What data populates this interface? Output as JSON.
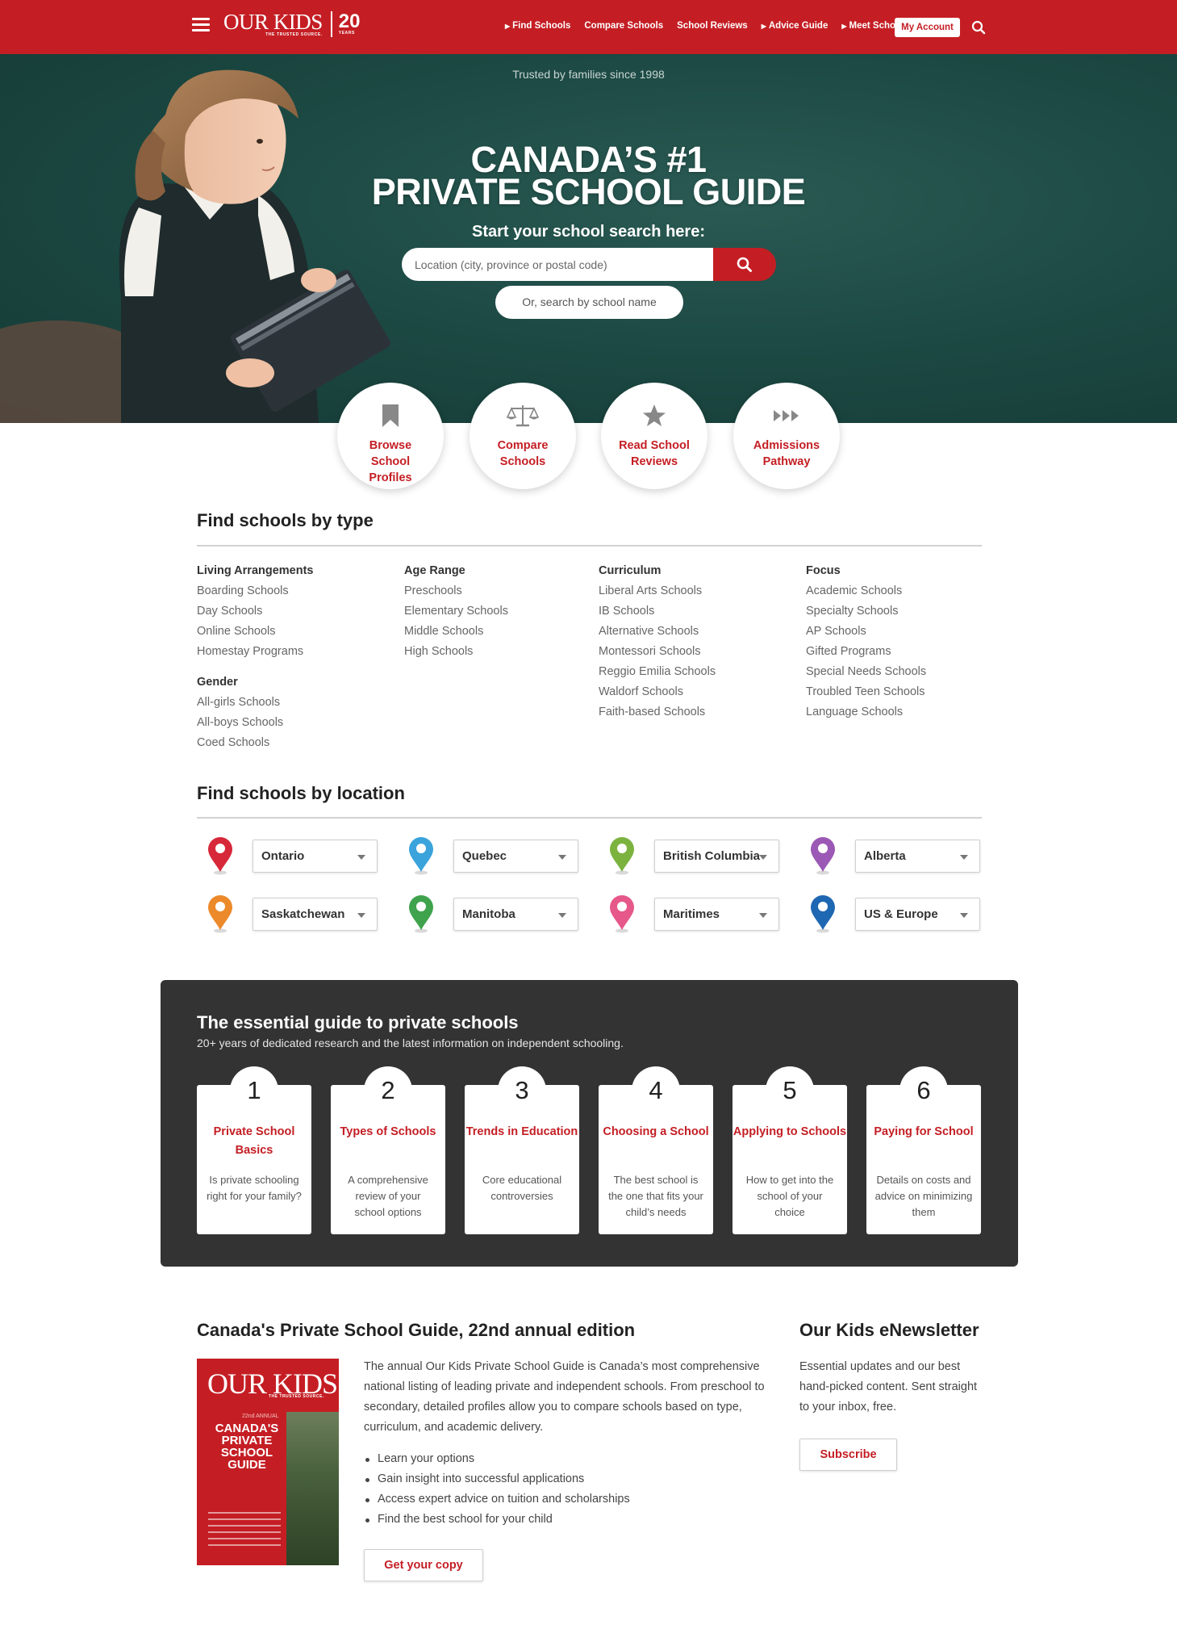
{
  "header": {
    "logo_text": "OUR KIDS",
    "logo_tagline": "THE TRUSTED SOURCE.",
    "anniversary_number": "20",
    "anniversary_label": "YEARS",
    "nav": [
      {
        "label": "Find Schools",
        "arrow": true
      },
      {
        "label": "Compare Schools",
        "arrow": false
      },
      {
        "label": "School Reviews",
        "arrow": false
      },
      {
        "label": "Advice Guide",
        "arrow": true
      },
      {
        "label": "Meet Schools",
        "arrow": true
      }
    ],
    "account_label": "My Account",
    "search_icon": "search-icon",
    "menu_icon": "hamburger-icon",
    "brand_color": "#c41e24"
  },
  "hero": {
    "trusted": "Trusted by families since 1998",
    "title_line1": "CANADA’S #1",
    "title_line2": "PRIVATE SCHOOL GUIDE",
    "subtitle": "Start your school search here:",
    "location_placeholder": "Location (city, province or postal code)",
    "name_search_label": "Or, search by school name"
  },
  "features": [
    {
      "label": "Browse School Profiles",
      "icon": "bookmark-icon"
    },
    {
      "label": "Compare Schools",
      "icon": "scale-icon"
    },
    {
      "label": "Read School Reviews",
      "icon": "star-icon"
    },
    {
      "label": "Admissions Pathway",
      "icon": "fast-forward-icon"
    }
  ],
  "by_type": {
    "heading": "Find schools by type",
    "columns": [
      {
        "groups": [
          {
            "title": "Living Arrangements",
            "items": [
              "Boarding Schools",
              "Day Schools",
              "Online Schools",
              "Homestay Programs"
            ]
          },
          {
            "title": "Gender",
            "items": [
              "All-girls Schools",
              "All-boys Schools",
              "Coed Schools"
            ]
          }
        ]
      },
      {
        "groups": [
          {
            "title": "Age Range",
            "items": [
              "Preschools",
              "Elementary Schools",
              "Middle Schools",
              "High Schools"
            ]
          }
        ]
      },
      {
        "groups": [
          {
            "title": "Curriculum",
            "items": [
              "Liberal Arts Schools",
              "IB Schools",
              "Alternative Schools",
              "Montessori Schools",
              "Reggio Emilia Schools",
              "Waldorf Schools",
              "Faith-based Schools"
            ]
          }
        ]
      },
      {
        "groups": [
          {
            "title": "Focus",
            "items": [
              "Academic Schools",
              "Specialty Schools",
              "AP Schools",
              "Gifted Programs",
              "Special Needs Schools",
              "Troubled Teen Schools",
              "Language Schools"
            ]
          }
        ]
      }
    ]
  },
  "by_location": {
    "heading": "Find schools by location",
    "regions": [
      {
        "label": "Ontario",
        "pin_color": "#d7283a"
      },
      {
        "label": "Quebec",
        "pin_color": "#3aa3dc"
      },
      {
        "label": "British Columbia",
        "pin_color": "#7cb33f"
      },
      {
        "label": "Alberta",
        "pin_color": "#9b58b5"
      },
      {
        "label": "Saskatchewan",
        "pin_color": "#ec8a2b"
      },
      {
        "label": "Manitoba",
        "pin_color": "#3fa34d"
      },
      {
        "label": "Maritimes",
        "pin_color": "#e55889"
      },
      {
        "label": "US & Europe",
        "pin_color": "#1e67b3"
      }
    ]
  },
  "guide": {
    "title": "The essential guide to private schools",
    "subtitle": "20+ years of dedicated research and the latest information on independent schooling.",
    "cards": [
      {
        "num": "1",
        "title": "Private School Basics",
        "desc": "Is private schooling right for your family?"
      },
      {
        "num": "2",
        "title": "Types of Schools",
        "desc": "A comprehensive review of your school options"
      },
      {
        "num": "3",
        "title": "Trends in Education",
        "desc": "Core educational controversies"
      },
      {
        "num": "4",
        "title": "Choosing a School",
        "desc": "The best school is the one that fits your child’s needs"
      },
      {
        "num": "5",
        "title": "Applying to Schools",
        "desc": "How to get into the school of your choice"
      },
      {
        "num": "6",
        "title": "Paying for School",
        "desc": "Details on costs and advice on minimizing them"
      }
    ]
  },
  "annual": {
    "heading": "Canada's Private School Guide, 22nd annual edition",
    "cover_logo": "OUR KIDS",
    "cover_tagline": "THE TRUSTED SOURCE.",
    "cover_edition": "22nd ANNUAL",
    "cover_title": "CANADA'S PRIVATE SCHOOL GUIDE",
    "paragraph": "The annual Our Kids Private School Guide is Canada’s most comprehensive national listing of leading private and independent schools. From preschool to secondary, detailed profiles allow you to compare schools based on type, curriculum, and academic delivery.",
    "bullets": [
      "Learn your options",
      "Gain insight into successful applications",
      "Access expert advice on tuition and scholarships",
      "Find the best school for your child"
    ],
    "cta": "Get your copy"
  },
  "newsletter": {
    "heading": "Our Kids eNewsletter",
    "paragraph": "Essential updates and our best hand-picked content. Sent straight to your inbox, free.",
    "cta": "Subscribe"
  }
}
